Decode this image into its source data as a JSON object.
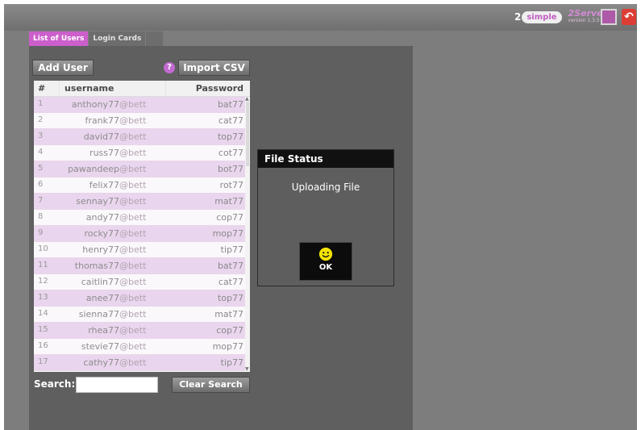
{
  "header": {
    "brand_number": "2",
    "brand_simple": "simple",
    "app_name": "2Serve",
    "version": "version 1.3.5"
  },
  "tabs": [
    {
      "label": "List of Users",
      "active": true
    },
    {
      "label": "Login Cards",
      "active": false
    }
  ],
  "toolbar": {
    "add_user_label": "Add User",
    "help_label": "?",
    "import_csv_label": "Import CSV"
  },
  "table": {
    "headers": {
      "num": "#",
      "username": "username",
      "password": "Password"
    },
    "rows": [
      {
        "num": "1",
        "username": "anthony77",
        "domain": "@bett",
        "password": "bat77"
      },
      {
        "num": "2",
        "username": "frank77",
        "domain": "@bett",
        "password": "cat77"
      },
      {
        "num": "3",
        "username": "david77",
        "domain": "@bett",
        "password": "top77"
      },
      {
        "num": "4",
        "username": "russ77",
        "domain": "@bett",
        "password": "cot77"
      },
      {
        "num": "5",
        "username": "pawandeep",
        "domain": "@bett",
        "password": "bot77"
      },
      {
        "num": "6",
        "username": "felix77",
        "domain": "@bett",
        "password": "rot77"
      },
      {
        "num": "7",
        "username": "sennay77",
        "domain": "@bett",
        "password": "mat77"
      },
      {
        "num": "8",
        "username": "andy77",
        "domain": "@bett",
        "password": "cop77"
      },
      {
        "num": "9",
        "username": "rocky77",
        "domain": "@bett",
        "password": "mop77"
      },
      {
        "num": "10",
        "username": "henry77",
        "domain": "@bett",
        "password": "tip77"
      },
      {
        "num": "11",
        "username": "thomas77",
        "domain": "@bett",
        "password": "bat77"
      },
      {
        "num": "12",
        "username": "caitlin77",
        "domain": "@bett",
        "password": "cat77"
      },
      {
        "num": "13",
        "username": "anee77",
        "domain": "@bett",
        "password": "top77"
      },
      {
        "num": "14",
        "username": "sienna77",
        "domain": "@bett",
        "password": "mat77"
      },
      {
        "num": "15",
        "username": "rhea77",
        "domain": "@bett",
        "password": "cop77"
      },
      {
        "num": "16",
        "username": "stevie77",
        "domain": "@bett",
        "password": "mop77"
      },
      {
        "num": "17",
        "username": "cathy77",
        "domain": "@bett",
        "password": "tip77"
      }
    ]
  },
  "search": {
    "label": "Search:",
    "value": ""
  },
  "clear_search_label": "Clear Search",
  "dialog": {
    "title": "File Status",
    "message": "Uploading File",
    "ok_label": "OK"
  },
  "icons": {
    "pc": "computer-icon",
    "exit": "exit-icon",
    "smiley": "smiley-icon"
  },
  "colors": {
    "accent": "#cc5fcc",
    "row_odd": "#ead5ee",
    "dialog_title_bg": "#111111",
    "smiley": "#f5e400"
  }
}
